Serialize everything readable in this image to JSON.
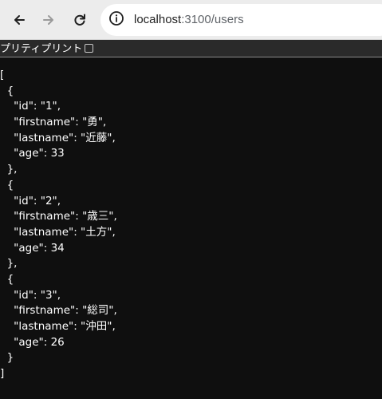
{
  "browser": {
    "url_host": "localhost",
    "url_path": ":3100/users"
  },
  "pretty_print": {
    "label": "プリティプリント",
    "checked": false
  },
  "json_lines": [
    "[",
    "  {",
    "    \"id\": \"1\",",
    "    \"firstname\": \"勇\",",
    "    \"lastname\": \"近藤\",",
    "    \"age\": 33",
    "  },",
    "  {",
    "    \"id\": \"2\",",
    "    \"firstname\": \"歳三\",",
    "    \"lastname\": \"土方\",",
    "    \"age\": 34",
    "  },",
    "  {",
    "    \"id\": \"3\",",
    "    \"firstname\": \"総司\",",
    "    \"lastname\": \"沖田\",",
    "    \"age\": 26",
    "  }",
    "]"
  ]
}
